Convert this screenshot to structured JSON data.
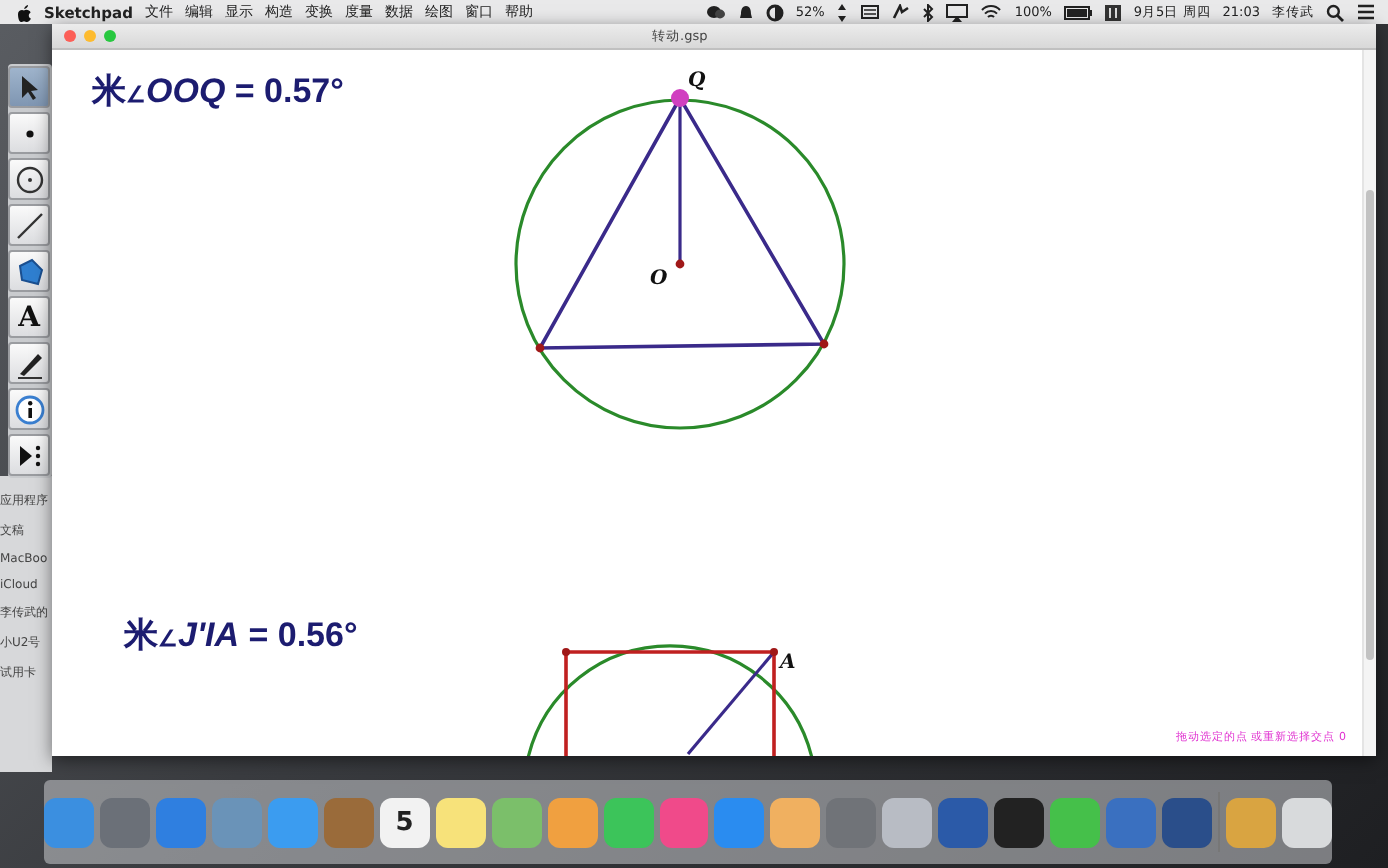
{
  "menu_bar": {
    "app_name": "Sketchpad",
    "menus": [
      "文件",
      "编辑",
      "显示",
      "构造",
      "变换",
      "度量",
      "数据",
      "绘图",
      "窗口",
      "帮助"
    ],
    "battery_small": "52%",
    "wifi_battery": "100%",
    "date": "9月5日 周四",
    "time": "21:03",
    "user": "李传武"
  },
  "background_sidebar": {
    "items": [
      "应用程序",
      "文稿",
      "MacBoo",
      "iCloud",
      "李传武的",
      "小U2号",
      "试用卡"
    ]
  },
  "tool_palette": {
    "tools": [
      {
        "kind": "arrow",
        "selected": true
      },
      {
        "kind": "point",
        "selected": false
      },
      {
        "kind": "compass",
        "selected": false
      },
      {
        "kind": "line",
        "selected": false
      },
      {
        "kind": "polygon",
        "selected": false
      },
      {
        "kind": "text",
        "label": "A",
        "selected": false
      },
      {
        "kind": "marker",
        "selected": false
      },
      {
        "kind": "info",
        "selected": false
      },
      {
        "kind": "custom",
        "selected": false
      }
    ]
  },
  "window": {
    "title": "转动.gsp",
    "measurements": [
      {
        "prefix": "米",
        "angle": "∠",
        "name": "OOQ",
        "value": " = 0.57°"
      },
      {
        "prefix": "米",
        "angle": "∠",
        "name": "J'IA",
        "value": " = 0.56°"
      }
    ],
    "point_labels": [
      "Q",
      "O",
      "A"
    ],
    "status_hint": "拖动选定的点 或重新选择交点 0"
  },
  "dock": {
    "apps": [
      {
        "color": "#3b8fe0"
      },
      {
        "color": "#6b7078"
      },
      {
        "color": "#2f7fe0"
      },
      {
        "color": "#6a93b8"
      },
      {
        "color": "#3b9cf0"
      },
      {
        "color": "#9a6b3a"
      },
      {
        "color": "#f2f2f2",
        "label": "5"
      },
      {
        "color": "#f7e27a"
      },
      {
        "color": "#7bbf6a"
      },
      {
        "color": "#f0a040"
      },
      {
        "color": "#3cc45a"
      },
      {
        "color": "#f04a8a"
      },
      {
        "color": "#2a8cf0"
      },
      {
        "color": "#f0b060"
      },
      {
        "color": "#707378"
      },
      {
        "color": "#b8bcc4"
      },
      {
        "color": "#2b5aa8"
      },
      {
        "color": "#222222"
      },
      {
        "color": "#45c04a"
      },
      {
        "color": "#3a70c0"
      },
      {
        "color": "#2a4e8a"
      },
      {
        "color": "#d9a441"
      },
      {
        "color": "#d8dadc"
      }
    ]
  }
}
